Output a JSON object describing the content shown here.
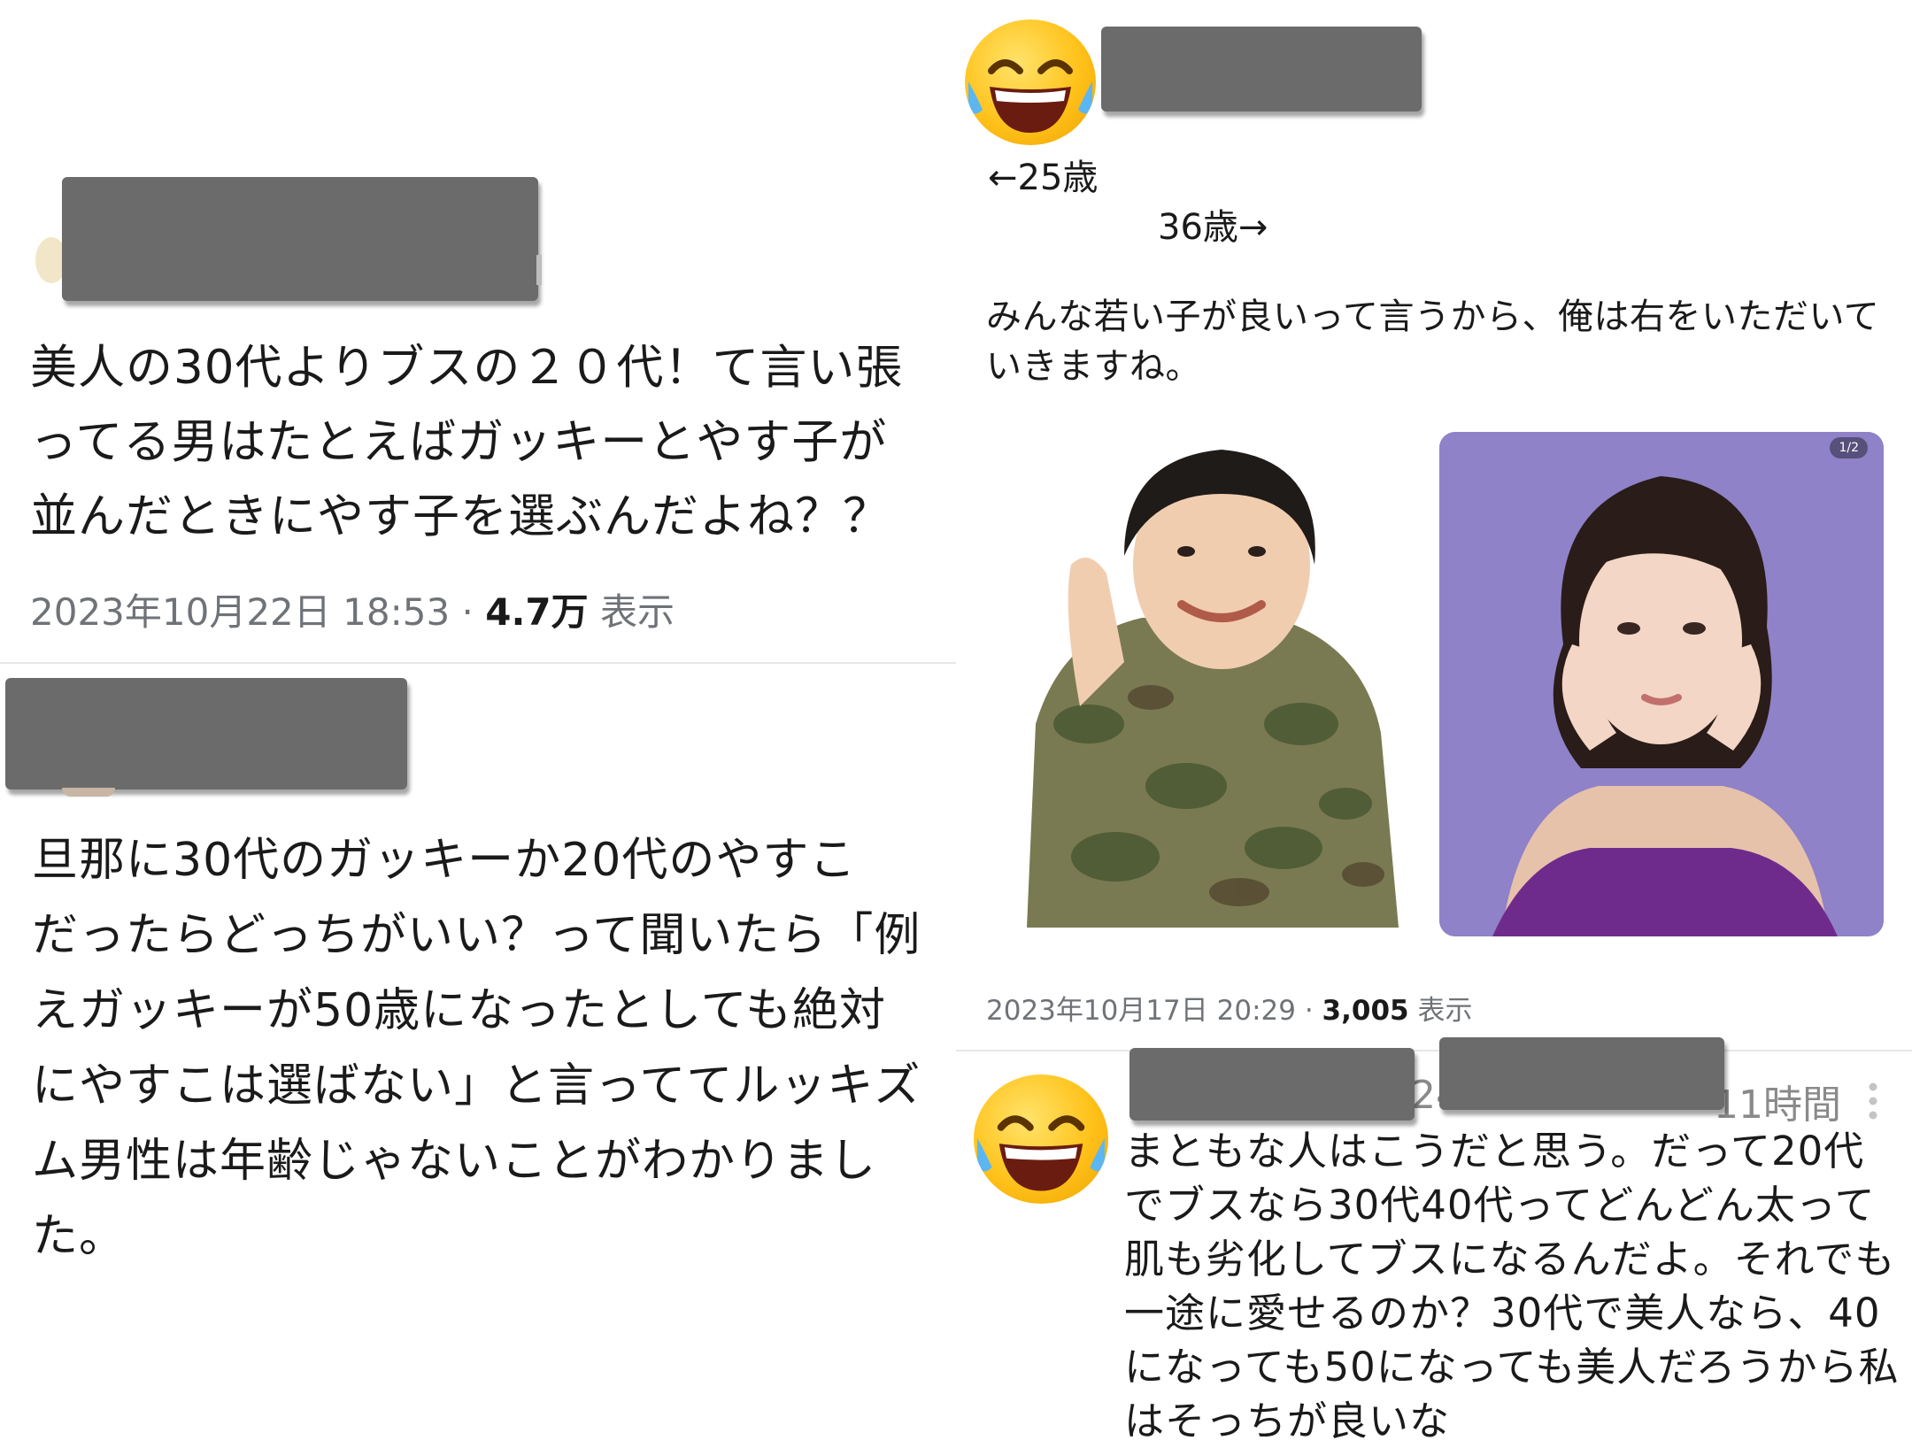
{
  "post1": {
    "text": "美人の30代よりブスの２０代！て言い張\nってる男はたとえばガッキーとやす子が\n並んだときにやす子を選ぶんだよね？？",
    "date": "2023年10月22日 18:53 · ",
    "views": "4.7万",
    "views_label": " 表示"
  },
  "post2": {
    "text": "旦那に30代のガッキーか20代のやすこ\nだったらどっちがいい？って聞いたら「例\nえガッキーが50歳になったとしても絶対\nにやすこは選ばない」と言っててルッキズ\nム男性は年齢じゃないことがわかりまし\nた。"
  },
  "post3": {
    "label_left": "←25歳",
    "label_right": "36歳→",
    "text": "みんな若い子が良いって言うから、俺は右をいただいて\nいきますね。",
    "photo_counter": "1/2",
    "date": "2023年10月17日 20:29 · ",
    "views": "3,005",
    "views_label": " 表示"
  },
  "post4": {
    "time_fragment": "24",
    "time_suffix": "11時間",
    "text": "まともな人はこうだと思う。だって20代\nでブスなら30代40代ってどんどん太って\n肌も劣化してブスになるんだよ。それでも\n一途に愛せるのか？30代で美人なら、40\nになっても50になっても美人だろうから私\nはそっちが良いな",
    "menu_icon": "more-vertical-icon"
  },
  "colors": {
    "redaction": "#6b6b6b",
    "meta_text": "#6f7378",
    "divider": "#e6e6e6",
    "photo_right_bg": "#8f82c8"
  }
}
